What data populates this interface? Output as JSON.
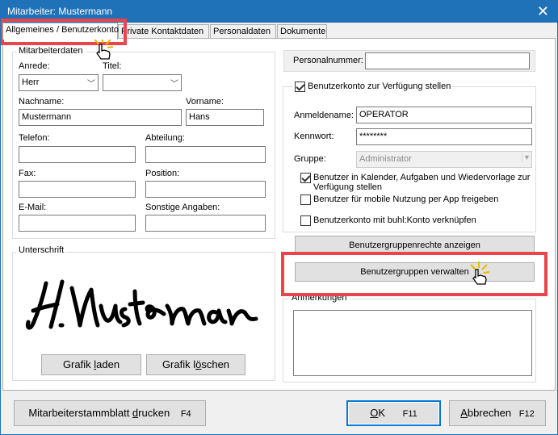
{
  "window": {
    "title": "Mitarbeiter: Mustermann"
  },
  "tabs": [
    {
      "label": "Allgemeines / Benutzerkonto"
    },
    {
      "label": "Private Kontaktdaten"
    },
    {
      "label": "Personaldaten"
    },
    {
      "label": "Dokumente"
    }
  ],
  "mitarbeiterdaten": {
    "group_label": "Mitarbeiterdaten",
    "anrede_label": "Anrede:",
    "anrede_value": "Herr",
    "titel_label": "Titel:",
    "titel_value": "",
    "nachname_label": "Nachname:",
    "nachname_value": "Mustermann",
    "vorname_label": "Vorname:",
    "vorname_value": "Hans",
    "telefon_label": "Telefon:",
    "telefon_value": "",
    "abteilung_label": "Abteilung:",
    "abteilung_value": "",
    "fax_label": "Fax:",
    "fax_value": "",
    "position_label": "Position:",
    "position_value": "",
    "email_label": "E-Mail:",
    "email_value": "",
    "sonstige_label": "Sonstige Angaben:",
    "sonstige_value": ""
  },
  "unterschrift": {
    "group_label": "Unterschrift",
    "grafik_laden_pre": "Grafik ",
    "grafik_laden_u": "l",
    "grafik_laden_post": "aden",
    "grafik_loeschen_pre": "Grafik l",
    "grafik_loeschen_u": "ö",
    "grafik_loeschen_post": "schen"
  },
  "personalnummer": {
    "label": "Personalnummer:",
    "value": ""
  },
  "benutzerkonto": {
    "enable_label": "Benutzerkonto zur Verfügung stellen",
    "anmeldename_label": "Anmeldename:",
    "anmeldename_value": "OPERATOR",
    "kennwort_label": "Kennwort:",
    "kennwort_value": "********",
    "gruppe_label": "Gruppe:",
    "gruppe_value": "Administrator",
    "kalender_line1": "Benutzer in Kalender, Aufgaben und Wiedervorlage zur",
    "kalender_line2": "Verfügung stellen",
    "mobile_label": "Benutzer für mobile Nutzung per App freigeben",
    "buhl_label": "Benutzerkonto mit buhl:Konto verknüpfen",
    "rechte_button": "Benutzergruppenrechte anzeigen",
    "verwalten_button": "Benutzergruppen verwalten"
  },
  "anmerkungen": {
    "group_label": "Anmerkungen"
  },
  "footer": {
    "drucken_pre": "Mitarbeiterstammblatt ",
    "drucken_u": "d",
    "drucken_post": "rucken",
    "drucken_key": "F4",
    "ok_u": "O",
    "ok_post": "K",
    "ok_key": "F11",
    "abbrechen_u": "A",
    "abbrechen_post": "bbrechen",
    "abbrechen_key": "F12"
  },
  "colors": {
    "titlebar": "#1f72b8",
    "highlight": "#e8454d",
    "primary_border": "#0078d7"
  }
}
